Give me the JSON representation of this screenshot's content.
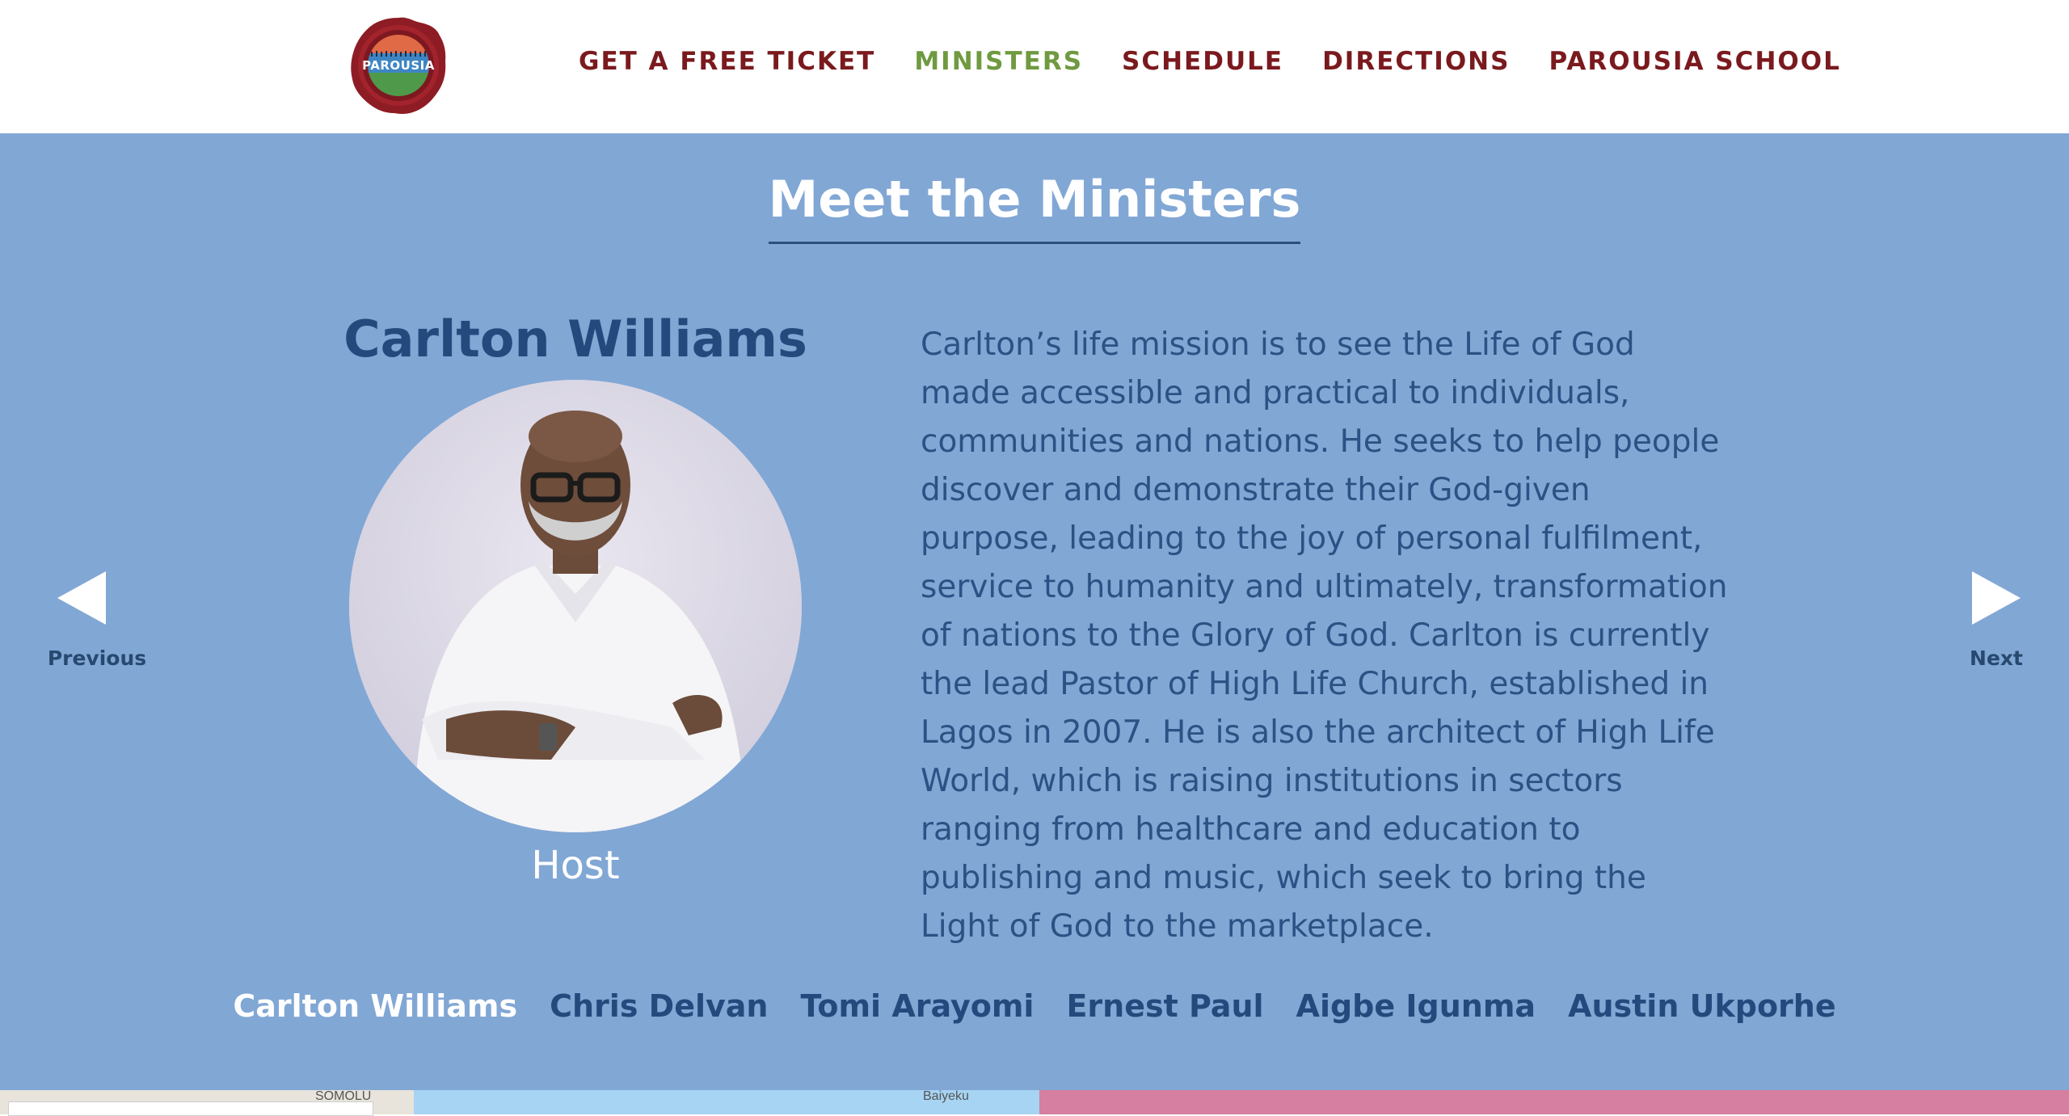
{
  "header": {
    "logo_text": "PAROUSIA",
    "nav": [
      {
        "label": "GET A FREE TICKET",
        "active": false
      },
      {
        "label": "MINISTERS",
        "active": true
      },
      {
        "label": "SCHEDULE",
        "active": false
      },
      {
        "label": "DIRECTIONS",
        "active": false
      },
      {
        "label": "PAROUSIA SCHOOL",
        "active": false
      }
    ]
  },
  "ministers_section": {
    "title": "Meet the Ministers",
    "current": {
      "name": "Carlton Williams",
      "role": "Host",
      "bio": "Carlton’s life mission is to see the Life of God made accessible and practical to individuals, communities and nations. He seeks to help people discover and demonstrate their God-given purpose, leading to the joy of personal fulfilment, service to humanity and ultimately, transformation of nations to the Glory of God. Carlton is currently the lead Pastor of High Life Church, established in Lagos in 2007. He is also the architect of High Life World, which is raising institutions in sectors ranging from healthcare and education to publishing and music, which seek to bring the Light of God to the marketplace."
    },
    "previous_label": "Previous",
    "next_label": "Next",
    "tabs": [
      {
        "label": "Carlton Williams",
        "active": true
      },
      {
        "label": "Chris Delvan",
        "active": false
      },
      {
        "label": "Tomi Arayomi",
        "active": false
      },
      {
        "label": "Ernest Paul",
        "active": false
      },
      {
        "label": "Aigbe Igunma",
        "active": false
      },
      {
        "label": "Austin Ukporhe",
        "active": false
      }
    ]
  },
  "map": {
    "labels": [
      "SOMOLU",
      "Baiyeku"
    ]
  },
  "colors": {
    "section_bg": "#81a7d5",
    "nav_text": "#7a1a1e",
    "nav_active": "#6f9a40",
    "heading_blue": "#244a7d"
  }
}
